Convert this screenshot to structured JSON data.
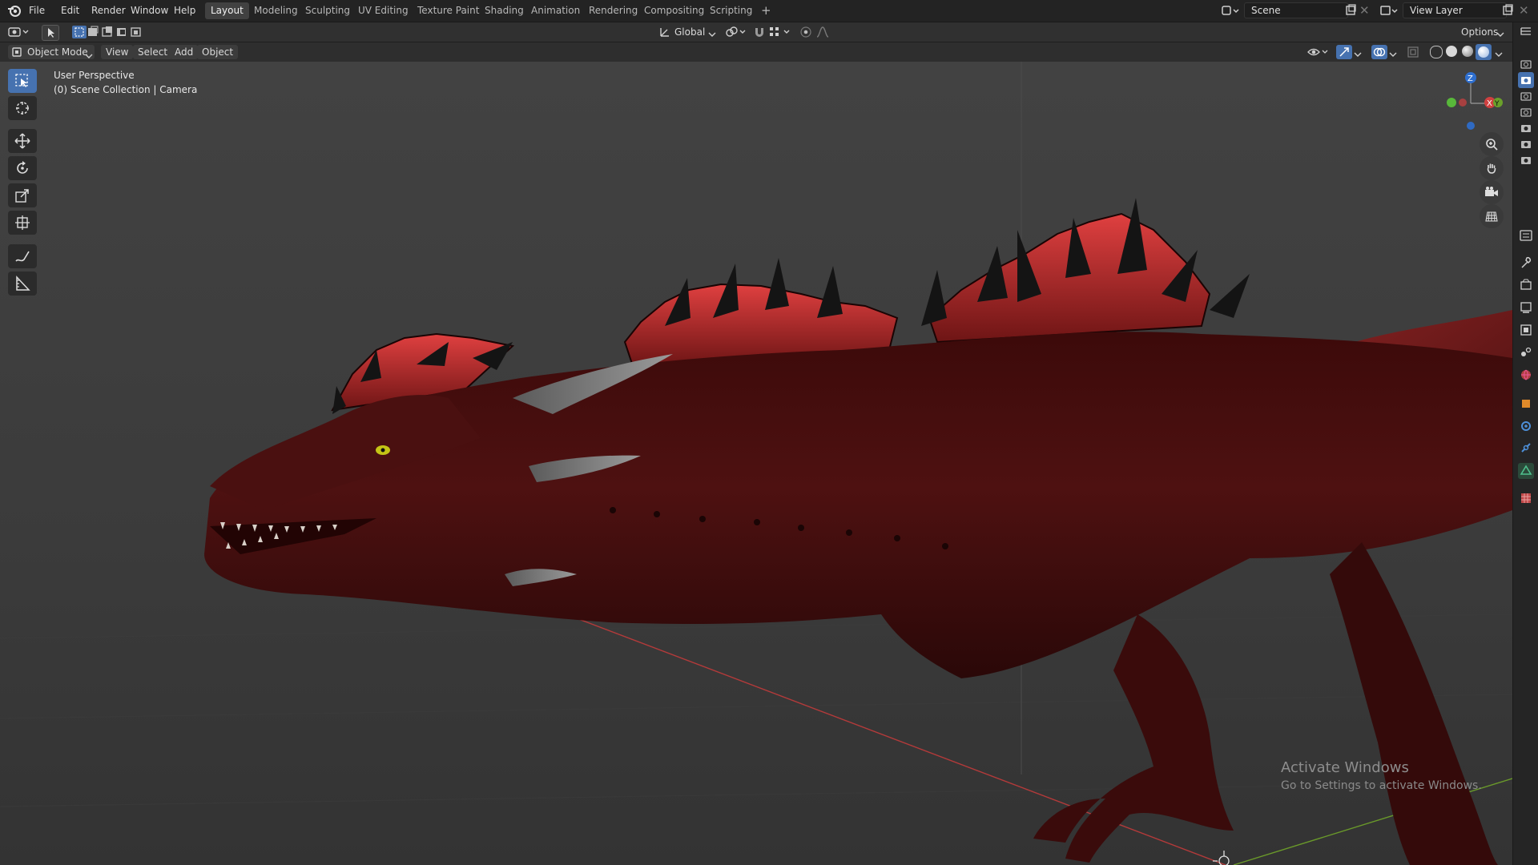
{
  "menu": [
    "File",
    "Edit",
    "Render",
    "Window",
    "Help"
  ],
  "workspaces": [
    {
      "label": "Layout",
      "active": true
    },
    {
      "label": "Modeling"
    },
    {
      "label": "Sculpting"
    },
    {
      "label": "UV Editing"
    },
    {
      "label": "Texture Paint"
    },
    {
      "label": "Shading"
    },
    {
      "label": "Animation"
    },
    {
      "label": "Rendering"
    },
    {
      "label": "Compositing"
    },
    {
      "label": "Scripting"
    }
  ],
  "add_workspace": "+",
  "scene": {
    "label": "Scene"
  },
  "view_layer": {
    "label": "View Layer"
  },
  "toolbar": {
    "transform_orientation": "Global",
    "options_label": "Options"
  },
  "header": {
    "mode": "Object Mode",
    "view": "View",
    "select": "Select",
    "add": "Add",
    "object": "Object"
  },
  "viewport": {
    "perspective": "User Perspective",
    "collection": "(0) Scene Collection | Camera"
  },
  "gizmo": {
    "z": "Z",
    "x": "X",
    "y": "Y"
  },
  "watermark": {
    "title": "Activate Windows",
    "subtitle": "Go to Settings to activate Windows."
  },
  "tools": [
    "select-box-icon",
    "cursor-icon",
    "move-icon",
    "rotate-icon",
    "scale-icon",
    "transform-icon",
    "annotate-icon",
    "measure-icon"
  ],
  "colors": {
    "accent": "#4672b0",
    "dragon": "#5a1414",
    "spikes": "#b02828"
  }
}
